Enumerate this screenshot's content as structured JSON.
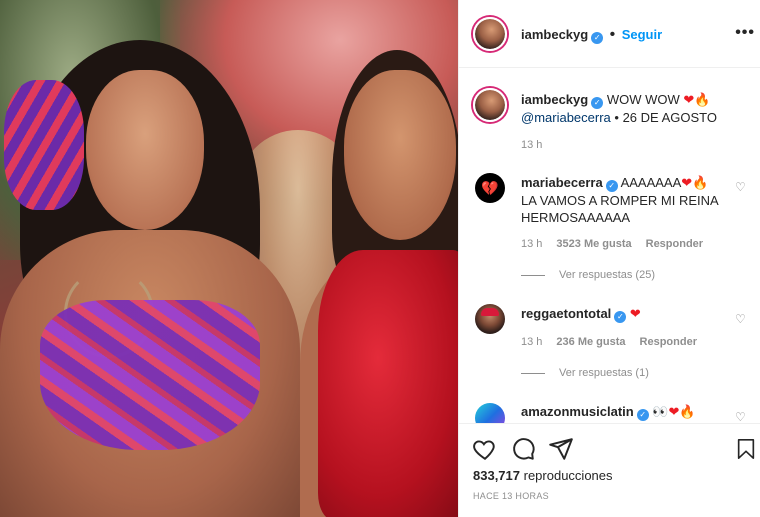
{
  "post": {
    "author": "iambeckyg",
    "follow_label": "Seguir",
    "more_label": "•••",
    "caption_text": "WOW WOW",
    "caption_emojis": [
      "red-heart",
      "fire"
    ],
    "caption_mention": "@mariabecerra",
    "caption_date": "• 26 DE AGOSTO",
    "caption_age": "13 h"
  },
  "comments": [
    {
      "user": "mariabecerra",
      "verified": true,
      "text": "AAAAAAA",
      "text2": "LA VAMOS A ROMPER MI REINA HERMOSAAAAAA",
      "emojis": [
        "red-heart",
        "fire"
      ],
      "age": "13 h",
      "likes": "3523 Me gusta",
      "reply_label": "Responder",
      "replies_label": "Ver respuestas (25)"
    },
    {
      "user": "reggaetontotal",
      "verified": true,
      "text": "",
      "emojis": [
        "red-heart"
      ],
      "age": "13 h",
      "likes": "236 Me gusta",
      "reply_label": "Responder",
      "replies_label": "Ver respuestas (1)"
    },
    {
      "user": "amazonmusiclatin",
      "verified": true,
      "text": "",
      "emojis": [
        "eyes",
        "heart-on-fire",
        "fire"
      ]
    }
  ],
  "footer": {
    "views_count": "833,717",
    "views_label": "reproducciones",
    "time_ago": "HACE 13 HORAS"
  },
  "colors": {
    "accent": "#0095f6",
    "verified": "#3897f0",
    "muted": "#8e8e8e",
    "heart": "#ed1c24"
  }
}
